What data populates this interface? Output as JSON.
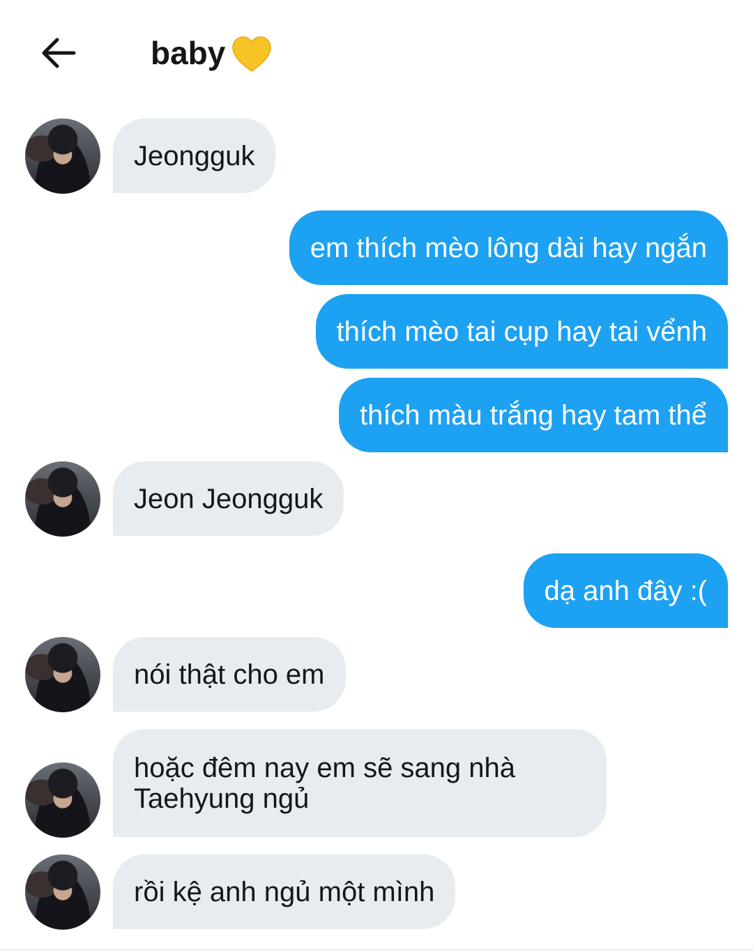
{
  "header": {
    "back_icon": "arrow-left-icon",
    "title": "baby",
    "emoji": "yellow-heart-icon"
  },
  "messages": [
    {
      "direction": "incoming",
      "text": "Jeongguk"
    },
    {
      "direction": "outgoing",
      "text": "em thích mèo lông dài hay ngắn"
    },
    {
      "direction": "outgoing",
      "text": "thích mèo tai cụp hay tai vểnh"
    },
    {
      "direction": "outgoing",
      "text": "thích màu trắng hay tam thể"
    },
    {
      "direction": "incoming",
      "text": "Jeon Jeongguk"
    },
    {
      "direction": "outgoing",
      "text": "dạ anh đây :("
    },
    {
      "direction": "incoming",
      "text": "nói thật cho em"
    },
    {
      "direction": "incoming",
      "text": "hoặc đêm nay em sẽ sang nhà Taehyung ngủ"
    },
    {
      "direction": "incoming",
      "text": "rồi kệ anh ngủ một mình"
    }
  ],
  "colors": {
    "outgoing_bubble": "#1da1f2",
    "incoming_bubble": "#e6ecf0",
    "heart": "#f7c325"
  }
}
